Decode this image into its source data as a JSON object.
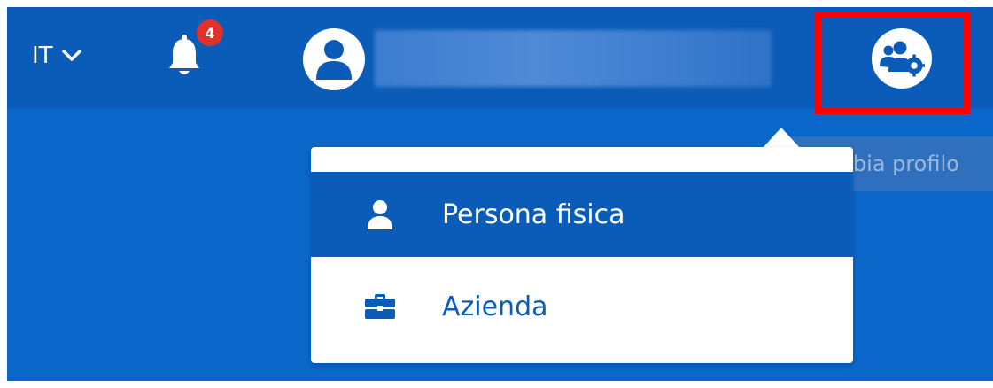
{
  "header": {
    "language": "IT",
    "notifications": {
      "count": "4"
    },
    "profile_switch": {
      "tooltip": "Cambia profilo"
    }
  },
  "profile_menu": {
    "items": [
      {
        "label": "Persona fisica",
        "icon": "user-icon",
        "selected": true
      },
      {
        "label": "Azienda",
        "icon": "briefcase-icon",
        "selected": false
      }
    ]
  },
  "colors": {
    "header_bg": "#0b5cb8",
    "page_bg": "#0a66c8",
    "badge": "#e0312b",
    "highlight": "#ff0000"
  }
}
